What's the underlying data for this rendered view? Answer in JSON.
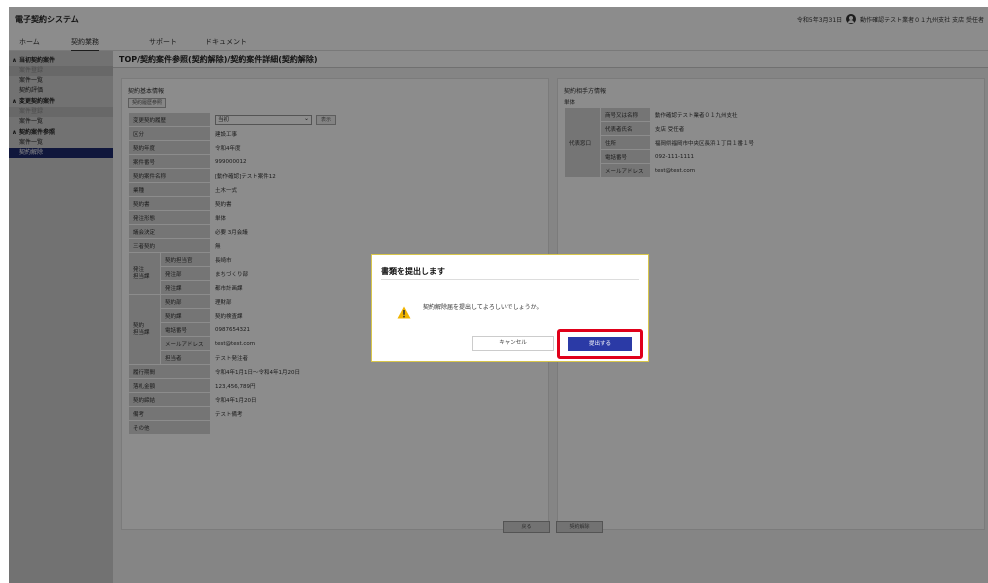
{
  "header": {
    "app_title": "電子契約システム",
    "user_info": "令和5年3月31日",
    "user_name": "動作確認テスト業者０１九州支社 支店 受任者",
    "user_icon": "user-circle-icon"
  },
  "nav": {
    "items": [
      "ホーム",
      "契約業務",
      "サポート",
      "ドキュメント"
    ],
    "active_index": 1
  },
  "sidebar": {
    "groups": [
      {
        "label": "∧ 当初契約案件",
        "items": [
          {
            "label": "案件登録",
            "state": "disabled"
          },
          {
            "label": "案件一覧",
            "state": "normal"
          },
          {
            "label": "契約評価",
            "state": "normal"
          }
        ]
      },
      {
        "label": "∧ 変更契約案件",
        "items": [
          {
            "label": "案件登録",
            "state": "disabled"
          },
          {
            "label": "案件一覧",
            "state": "normal"
          }
        ]
      },
      {
        "label": "∧ 契約案件参照",
        "items": [
          {
            "label": "案件一覧",
            "state": "normal"
          },
          {
            "label": "契約解除",
            "state": "active"
          }
        ]
      }
    ]
  },
  "breadcrumb": "TOP/契約案件参照(契約解除)/契約案件詳細(契約解除)",
  "left_panel": {
    "title": "契約基本情報",
    "history_button": "契約履歴参照",
    "rows": [
      {
        "label": "変更契約履歴",
        "select": "当初",
        "display_button": "表示"
      },
      {
        "label": "区分",
        "value": "建設工事"
      },
      {
        "label": "契約年度",
        "value": "令和4年度"
      },
      {
        "label": "案件番号",
        "value": "999000012"
      },
      {
        "label": "契約案件名称",
        "value": "[動作確認]テスト案件12"
      },
      {
        "label": "業種",
        "value": "土木一式"
      },
      {
        "label": "契約書",
        "value": "契約書"
      },
      {
        "label": "発注形態",
        "value": "単体"
      },
      {
        "label": "議会決定",
        "value": "必要  3月会議"
      },
      {
        "label": "三者契約",
        "value": "無"
      }
    ],
    "order_section": {
      "group_label": "発注\n担当課",
      "rows": [
        {
          "label": "契約担当官",
          "value": "長崎市"
        },
        {
          "label": "発注部",
          "value": "まちづくり部"
        },
        {
          "label": "発注課",
          "value": "都市計画課"
        }
      ]
    },
    "contract_section": {
      "group_label": "契約\n担当課",
      "rows": [
        {
          "label": "契約部",
          "value": "理財部"
        },
        {
          "label": "契約課",
          "value": "契約検査課"
        },
        {
          "label": "電話番号",
          "value": "0987654321"
        },
        {
          "label": "メールアドレス",
          "value": "test@test.com"
        },
        {
          "label": "担当者",
          "value": "テスト発注者"
        }
      ]
    },
    "rows_after": [
      {
        "label": "履行期間",
        "value": "令和4年1月1日～令和4年1月20日"
      },
      {
        "label": "落札金額",
        "value": "123,456,789円"
      },
      {
        "label": "契約締結",
        "value": "令和4年1月20日"
      },
      {
        "label": "備考",
        "value": "テスト備考"
      },
      {
        "label": "その他",
        "value": ""
      }
    ]
  },
  "right_panel": {
    "title": "契約相手方情報",
    "type_label": "単体",
    "group_label": "代表窓口",
    "rows": [
      {
        "label": "商号又は名称",
        "value": "動作確認テスト業者０１九州支社"
      },
      {
        "label": "代表者氏名",
        "value": "支店 受任者"
      },
      {
        "label": "住所",
        "value": "福岡県福岡市中央区長浜１丁目１番１号"
      },
      {
        "label": "電話番号",
        "value": "092-111-1111"
      },
      {
        "label": "メールアドレス",
        "value": "test@test.com"
      }
    ]
  },
  "bottom_buttons": {
    "back": "戻る",
    "cancel_contract": "契約解除"
  },
  "dialog": {
    "title": "書類を提出します",
    "message": "契約解除届を提出してよろしいでしょうか。",
    "cancel": "キャンセル",
    "submit": "提出する",
    "warning_icon": "warning-triangle-icon",
    "highlight_color": "#e0001a"
  },
  "colors": {
    "sidebar_active": "#1e2a6e",
    "submit_button": "#2b3aa6"
  }
}
